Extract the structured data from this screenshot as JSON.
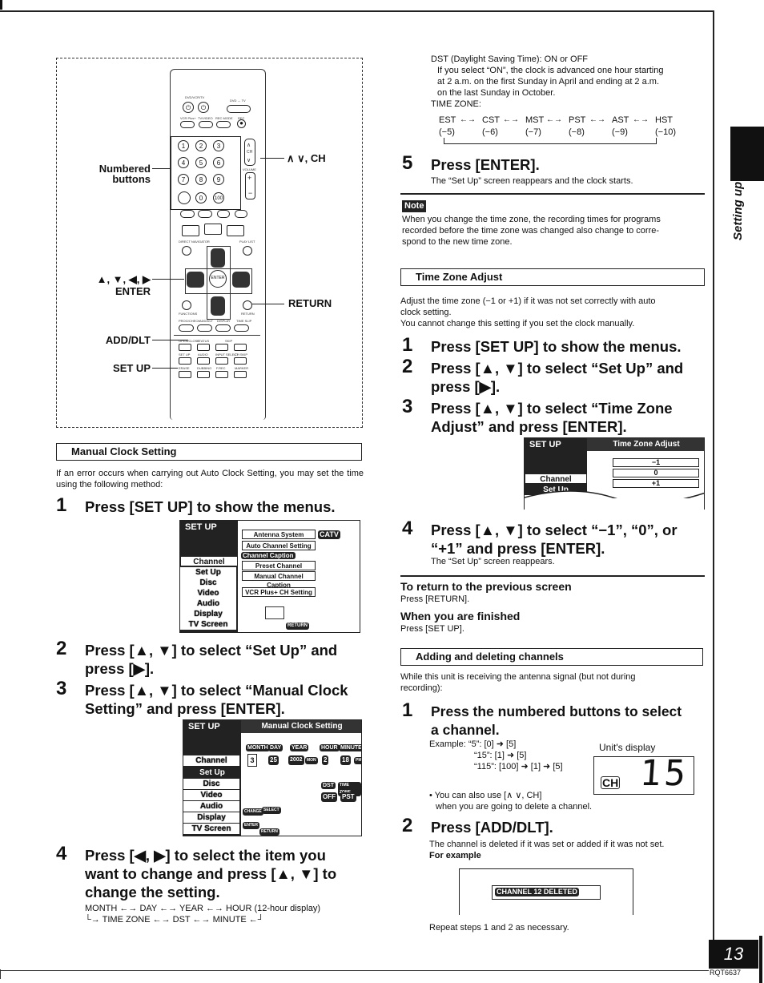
{
  "page": {
    "section_tab": "Setting up",
    "page_number": "13",
    "doc_code": "RQT6637"
  },
  "remote_figure": {
    "callouts": {
      "numbered_buttons": [
        "Numbered",
        "buttons"
      ],
      "channel": "∧ ∨, CH",
      "arrows": "▲, ▼, ◀, ▶",
      "enter": "ENTER",
      "return": "RETURN",
      "add_dlt": "ADD/DLT",
      "set_up": "SET UP"
    },
    "button_labels": {
      "power_dvd": "DVD/VCR/TV",
      "dvd_tv": "DVD ↔ TV",
      "vcrplus": "VCR Plus+",
      "tvvideo": "TV/VIDEO",
      "recmode": "REC MODE",
      "rec": "REC",
      "ch": "CH",
      "volume": "VOLUME",
      "digits": [
        "1",
        "2",
        "3",
        "4",
        "5",
        "6",
        "7",
        "8",
        "9",
        "0",
        "100"
      ],
      "direct_navigator": "DIRECT NAVIGATOR",
      "play_list": "PLAY LIST",
      "top": "TOP",
      "menu": "MENU",
      "enter": "ENTER",
      "functions": "FUNCTIONS",
      "return": "RETURN",
      "prog_check": "PROG/CHECK",
      "add_dlt": "ADD/DLT",
      "display": "DISPLAY",
      "time_slip": "TIME SLIP",
      "open_close": "OPEN/CLOSE",
      "status": "STATUS",
      "skip": "SKIP",
      "setup": "SET UP",
      "audio": "AUDIO",
      "input_select": "INPUT SELECT",
      "ch_skip": "CH SKIP",
      "erase": "ERASE",
      "dubbing": "DUBBING",
      "f_rec": "F.REC",
      "marker": "MARKER"
    }
  },
  "manual_clock": {
    "heading": "Manual Clock Setting",
    "intro": "If an error occurs when carrying out Auto Clock Setting, you may set the time using the following method:",
    "step1": {
      "num": "1",
      "text": "Press [SET UP] to show the menus."
    },
    "screen1": {
      "title": "SET UP",
      "menu": [
        "Channel",
        "Set Up",
        "Disc",
        "Video",
        "Audio",
        "Display",
        "TV Screen"
      ],
      "selected": "Channel",
      "options": [
        "Antenna System",
        "Auto Channel Setting",
        "Channel Caption",
        "Preset Channel Caption",
        "Manual Channel Caption",
        "VCR Plus+ CH Setting"
      ],
      "antenna_value": "CATV",
      "hint_return": "RETURN"
    },
    "step2": {
      "num": "2",
      "text_l1": "Press [▲, ▼] to select “Set Up” and",
      "text_l2": "press [▶]."
    },
    "step3": {
      "num": "3",
      "text_l1": "Press [▲, ▼] to select “Manual Clock",
      "text_l2": "Setting” and press [ENTER]."
    },
    "screen2": {
      "title": "SET UP",
      "header": "Manual Clock Setting",
      "menu": [
        "Channel",
        "Set Up",
        "Disc",
        "Video",
        "Audio",
        "Display",
        "TV Screen"
      ],
      "selected": "Set Up",
      "fields": [
        {
          "label": "MONTH",
          "value": "3"
        },
        {
          "label": "DAY",
          "value": "25"
        },
        {
          "label": "YEAR",
          "value": "2002"
        },
        {
          "label": "HOUR",
          "value": "2"
        },
        {
          "label": "MINUTE",
          "value": "18"
        }
      ],
      "weekday": "MON",
      "ampm": "PM",
      "dst_label": "DST",
      "dst_value": "OFF",
      "tz_label": "TIME ZONE",
      "tz_value": "PST",
      "hints": [
        "CHANGE",
        "SELECT",
        "ENTER",
        "RETURN"
      ]
    },
    "step4": {
      "num": "4",
      "text_l1": "Press [◀, ▶] to select the item you",
      "text_l2": "want to change and press [▲, ▼] to",
      "text_l3": "change the setting."
    },
    "order_line1": "MONTH ←→ DAY ←→ YEAR ←→ HOUR (12-hour display)",
    "order_line2": "└→ TIME ZONE ←→ DST ←→ MINUTE ←┘",
    "dst_title": "DST (Daylight Saving Time): ON or OFF",
    "dst_desc": [
      "If you select “ON”, the clock is advanced one hour starting",
      "at 2 a.m. on the first Sunday in April and ending at 2 a.m.",
      "on the last Sunday in October."
    ],
    "tz_title": "TIME ZONE:",
    "time_zones": [
      {
        "name": "EST",
        "offset": "(−5)"
      },
      {
        "name": "CST",
        "offset": "(−6)"
      },
      {
        "name": "MST",
        "offset": "(−7)"
      },
      {
        "name": "PST",
        "offset": "(−8)"
      },
      {
        "name": "AST",
        "offset": "(−9)"
      },
      {
        "name": "HST",
        "offset": "(−10)"
      }
    ],
    "step5": {
      "num": "5",
      "text": "Press [ENTER].",
      "desc": "The “Set Up” screen reappears and the clock starts."
    }
  },
  "note": {
    "label": "Note",
    "text_lines": [
      "When you change the time zone, the recording times for programs",
      "recorded before the time zone was changed also change to corre-",
      "spond to the new time zone."
    ]
  },
  "time_zone_adjust": {
    "heading": "Time Zone Adjust",
    "intro": [
      "Adjust the time zone (−1 or +1) if it was not set correctly with auto",
      "clock setting.",
      "You cannot change this setting if you set the clock manually."
    ],
    "step1": {
      "num": "1",
      "text": "Press [SET UP] to show the menus."
    },
    "step2": {
      "num": "2",
      "text_l1": "Press [▲, ▼] to select “Set Up” and",
      "text_l2": "press [▶]."
    },
    "step3": {
      "num": "3",
      "text_l1": "Press [▲, ▼] to select “Time Zone",
      "text_l2": "Adjust” and press [ENTER]."
    },
    "screen": {
      "title": "SET UP",
      "header": "Time Zone Adjust",
      "menu": [
        "Channel",
        "Set Up"
      ],
      "options": [
        "−1",
        "0",
        "+1"
      ]
    },
    "step4": {
      "num": "4",
      "text_l1": "Press [▲, ▼] to select “−1”, “0”, or",
      "text_l2": "“+1” and press [ENTER].",
      "desc": "The “Set Up” screen reappears."
    }
  },
  "return_info": {
    "title1": "To return to the previous screen",
    "desc1": "Press [RETURN].",
    "title2": "When you are finished",
    "desc2": "Press [SET UP]."
  },
  "add_delete": {
    "heading": "Adding and deleting channels",
    "intro": [
      "While this unit is receiving the antenna signal (but not during",
      "recording):"
    ],
    "step1": {
      "num": "1",
      "text_l1": "Press the numbered buttons to select",
      "text_l2": "a channel."
    },
    "examples": [
      "Example: “5”: [0] ➜ [5]",
      "“15”: [1] ➜ [5]",
      "“115”: [100] ➜ [1] ➜ [5]"
    ],
    "display_label": "Unit's display",
    "display_ch": "CH",
    "display_value": "15",
    "bullet": [
      "You can also use [∧ ∨, CH]",
      "when you are going to delete a channel."
    ],
    "step2": {
      "num": "2",
      "text": "Press [ADD/DLT]."
    },
    "step2_desc": "The channel is deleted if it was set or added if it was not set.",
    "for_example": "For example",
    "osd_message": "CHANNEL 12 DELETED",
    "repeat": "Repeat steps 1 and 2 as necessary."
  }
}
